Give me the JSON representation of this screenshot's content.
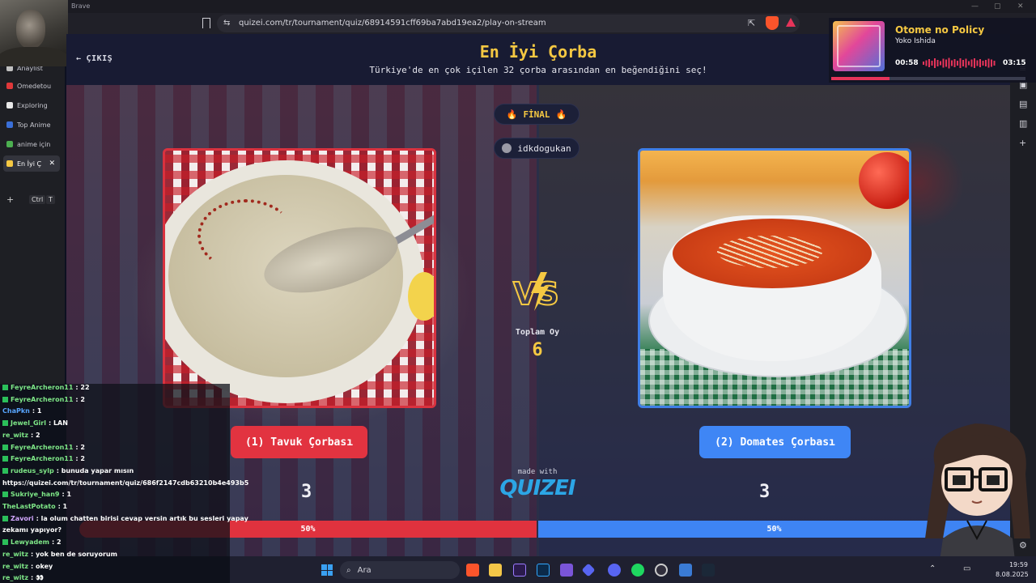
{
  "browser": {
    "app_name": "Brave",
    "url": "quizei.com/tr/tournament/quiz/68914591cff69ba7abd19ea2/play-on-stream",
    "tabs": [
      {
        "label": "Anaylist",
        "color": "#c0c0c0"
      },
      {
        "label": "Omedetou",
        "color": "#e0383a"
      },
      {
        "label": "Exploring",
        "color": "#e8e8e8"
      },
      {
        "label": "Top Anime",
        "color": "#3a6fd8"
      },
      {
        "label": "anime için",
        "color": "#4caf50"
      },
      {
        "label": "En İyi Ç",
        "color": "#f5c842",
        "active": true
      }
    ],
    "new_tab_shortcut": [
      "Ctrl",
      "T"
    ]
  },
  "header": {
    "exit_label": "ÇIKIŞ",
    "title": "En İyi Çorba",
    "subtitle": "Türkiye'de en çok içilen 32 çorba arasından en beğendiğini seç!"
  },
  "round": {
    "label": "FİNAL",
    "host": "idkdogukan"
  },
  "center": {
    "vs_label": "VS",
    "total_votes_label": "Toplam Oy",
    "total_votes": "6",
    "made_with": "made with",
    "brand": "QUIZEI"
  },
  "options": [
    {
      "label": "(1) Tavuk Çorbası",
      "votes": "3",
      "percent": "50%",
      "share": 0.5,
      "color": "#e23340"
    },
    {
      "label": "(2) Domates Çorbası",
      "votes": "3",
      "percent": "50%",
      "share": 0.5,
      "color": "#3f86f5"
    }
  ],
  "music": {
    "song": "Otome no Policy",
    "artist": "Yoko Ishida",
    "current": "00:58",
    "total": "03:15",
    "progress": 0.3
  },
  "chat": [
    {
      "user": "FeyreArcheron11",
      "text": "22",
      "color": "#7ee787",
      "badge": true
    },
    {
      "user": "FeyreArcheron11",
      "text": "2",
      "color": "#7ee787",
      "badge": true
    },
    {
      "user": "ChaPkn",
      "text": "1",
      "color": "#58a6ff",
      "badge": false
    },
    {
      "user": "Jewel_Girl",
      "text": "LAN",
      "color": "#7ee787",
      "badge": true
    },
    {
      "user": "re_witz",
      "text": "2",
      "color": "#7ee787",
      "badge": false
    },
    {
      "user": "FeyreArcheron11",
      "text": "2",
      "color": "#7ee787",
      "badge": true
    },
    {
      "user": "FeyreArcheron11",
      "text": "2",
      "color": "#7ee787",
      "badge": true
    },
    {
      "user": "rudeus_sylp",
      "text": "bunuda yapar mısın",
      "color": "#7ee787",
      "badge": true
    },
    {
      "user": "",
      "text": "https://quizei.com/tr/tournament/quiz/686f2147cdb63210b4e493b5",
      "color": "#ffffff",
      "badge": false
    },
    {
      "user": "Sukriye_han9",
      "text": "1",
      "color": "#7ee787",
      "badge": true
    },
    {
      "user": "TheLastPotato",
      "text": "1",
      "color": "#7ee787",
      "badge": false
    },
    {
      "user": "Zavori",
      "text": "la olum chatten birisi cevap versin artık bu sesleri yapay",
      "color": "#d2a8ff",
      "badge": true
    },
    {
      "user": "",
      "text": "zekamı yapıyor?",
      "color": "#ffffff",
      "badge": false
    },
    {
      "user": "Lewyadem",
      "text": "2",
      "color": "#7ee787",
      "badge": true
    },
    {
      "user": "re_witz",
      "text": "yok ben de soruyorum",
      "color": "#7ee787",
      "badge": false
    },
    {
      "user": "re_witz",
      "text": "okey",
      "color": "#7ee787",
      "badge": false
    },
    {
      "user": "re_witz",
      "text": "👀",
      "color": "#7ee787",
      "badge": false
    }
  ],
  "taskbar": {
    "search_placeholder": "Ara",
    "time": "19:59",
    "date": "8.08.2025"
  }
}
